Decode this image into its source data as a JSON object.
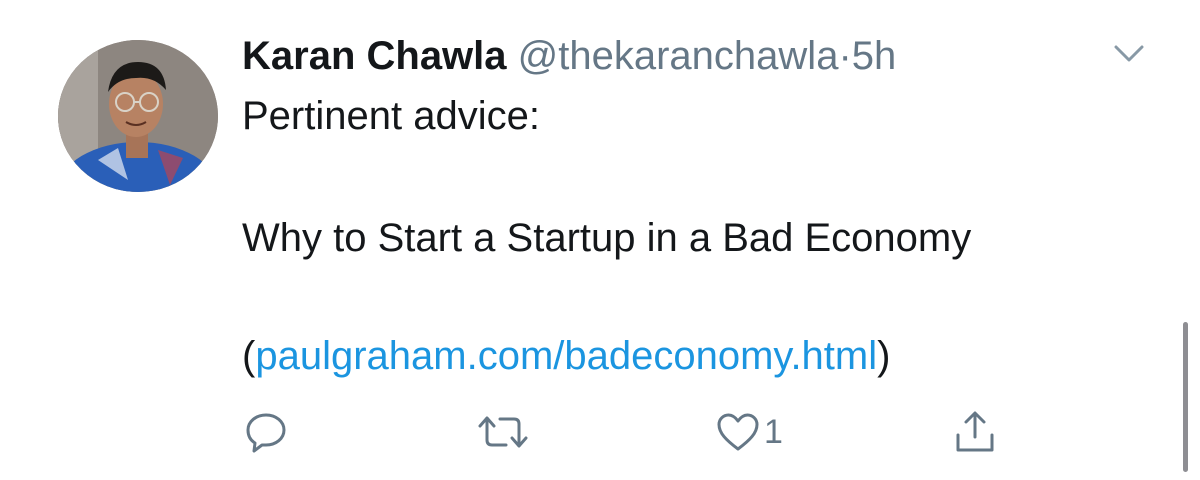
{
  "tweet": {
    "author": {
      "name": "Karan Chawla",
      "handle": "@thekaranchawla",
      "separator": "·",
      "time": "5h"
    },
    "body": {
      "line1": "Pertinent advice:",
      "line2": "Why to Start a Startup in a Bad Economy",
      "link_open": "(",
      "link_text": "paulgraham.com/badeconomy.html",
      "link_close": ")"
    },
    "actions": {
      "like_count": "1"
    }
  },
  "icons": {
    "caret": "chevron-down-icon",
    "reply": "reply-icon",
    "retweet": "retweet-icon",
    "like": "heart-icon",
    "share": "share-icon"
  },
  "colors": {
    "text": "#14171a",
    "secondary": "#657786",
    "link": "#1b95e0",
    "background": "#ffffff"
  }
}
